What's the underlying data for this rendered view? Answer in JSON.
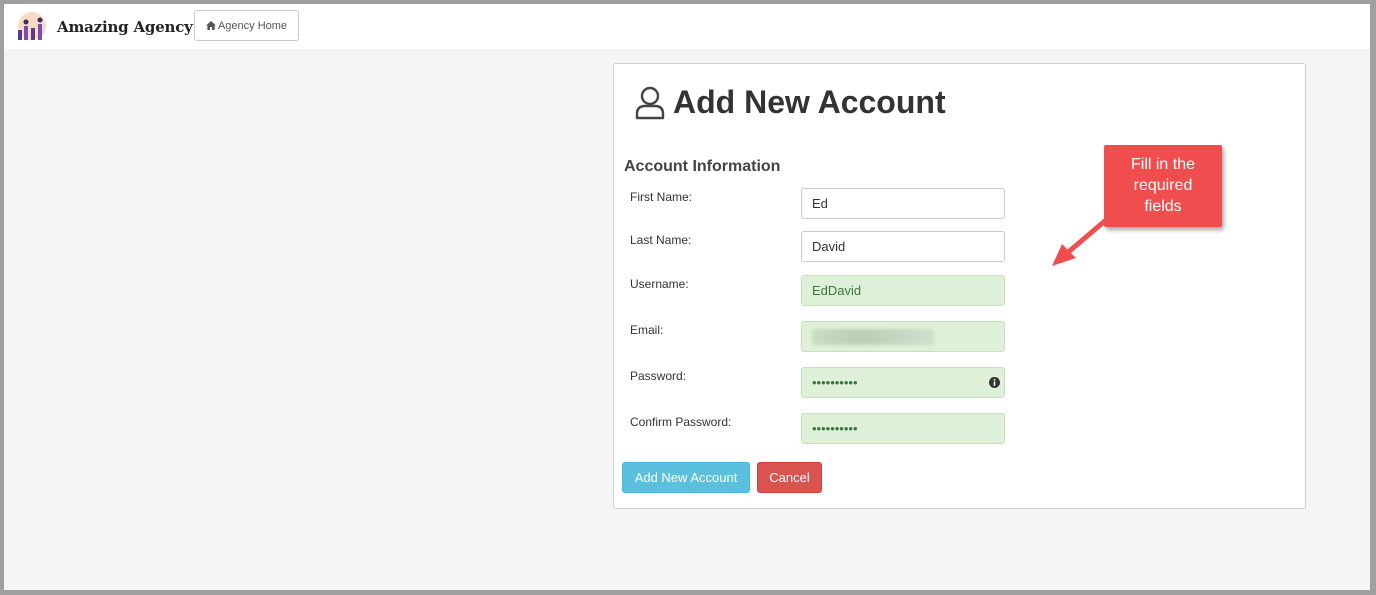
{
  "header": {
    "brand_name": "Amazing Agency",
    "home_button_label": "Agency Home"
  },
  "form": {
    "title": "Add New Account",
    "section_title": "Account Information",
    "fields": [
      {
        "label": "First Name:",
        "value": "Ed"
      },
      {
        "label": "Last Name:",
        "value": "David"
      },
      {
        "label": "Username:",
        "value": "EdDavid"
      },
      {
        "label": "Email:",
        "value": ""
      },
      {
        "label": "Password:",
        "value": "••••••••••"
      },
      {
        "label": "Confirm Password:",
        "value": "••••••••••"
      }
    ],
    "submit_label": "Add New Account",
    "cancel_label": "Cancel"
  },
  "annotation": {
    "callout_lines": [
      "Fill in the",
      "required",
      "fields"
    ]
  },
  "colors": {
    "valid_field_bg": "#dff0d8",
    "primary_button": "#5bc0de",
    "danger_button": "#d9534f",
    "callout": "#f04e4e"
  },
  "icons": {
    "logo": "agency-logo-icon",
    "home": "home-icon",
    "title": "user-icon",
    "password_info": "info-icon",
    "callout_arrow": "arrow-icon"
  }
}
